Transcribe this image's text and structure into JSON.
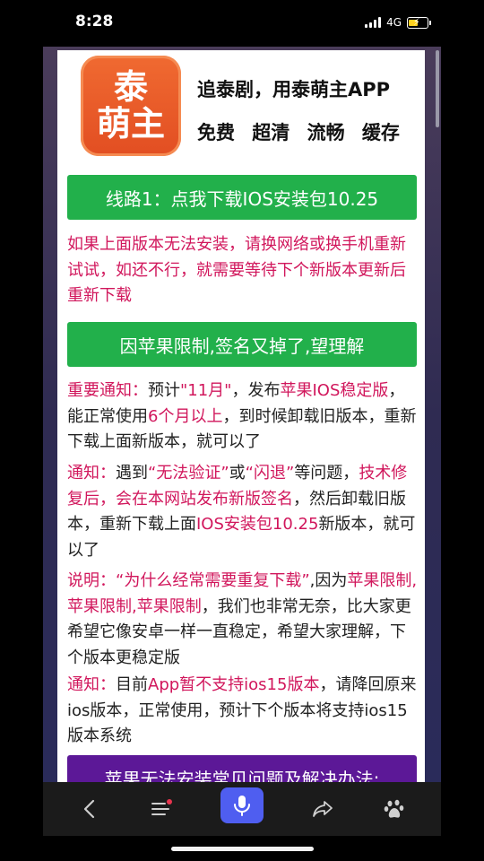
{
  "status_bar": {
    "time": "8:28",
    "network": "4G",
    "battery_color": "#ffd21f"
  },
  "header": {
    "logo_line1": "泰",
    "logo_line2": "萌主",
    "slogan1": "追泰剧，用泰萌主APP",
    "slogan2": "免费 超清 流畅 缓存"
  },
  "download_button": "线路1：点我下载IOS安装包10.25",
  "retry_note": "如果上面版本无法安装，请换网络或换手机重新试试，如还不行，就需要等待下个新版本更新后重新下载",
  "sign_notice_button": "因苹果限制,签名又掉了,望理解",
  "notice1": {
    "a": "重要通知：",
    "b": "预计",
    "c": "\"11月\"",
    "d": "，发布",
    "e": "苹果IOS稳定版",
    "f": "，能正常使用",
    "g": "6个月以上",
    "h": "，到时候卸载旧版本，重新下载上面新版本，就可以了"
  },
  "notice2": {
    "a": "通知：",
    "b": "遇到",
    "c": "“无法验证”",
    "d": "或",
    "e": "“闪退”",
    "f": "等问题，",
    "g": "技术修复后，会在本网站发布新版签名",
    "h": "，然后卸载旧版本，重新下载上面",
    "i": "IOS安装包10.25",
    "j": "新版本，就可以了"
  },
  "notice3": {
    "a": "说明：“为什么经常需要重复下载”",
    "b": ",因为",
    "c": "苹果限制,苹果限制,苹果限制",
    "d": "，我们也非常无奈，比大家更希望它像安卓一样一直稳定，希望大家理解，下个版本更稳定版"
  },
  "notice4": {
    "a": "通知：",
    "b": "目前",
    "c": "App暂不支持ios15版本",
    "d": "，请降回原来ios版本，正常使用，预计下个版本将支持ios15版本系统"
  },
  "faq_button": "苹果无法安装常见问题及解决办法:",
  "toolbar": {
    "back_icon": "chevron-left",
    "menu_icon": "menu-with-dot",
    "mic_icon": "microphone",
    "share_icon": "share-arrow",
    "baidu_icon": "baidu-paw",
    "accent": "#4f5ef0"
  }
}
